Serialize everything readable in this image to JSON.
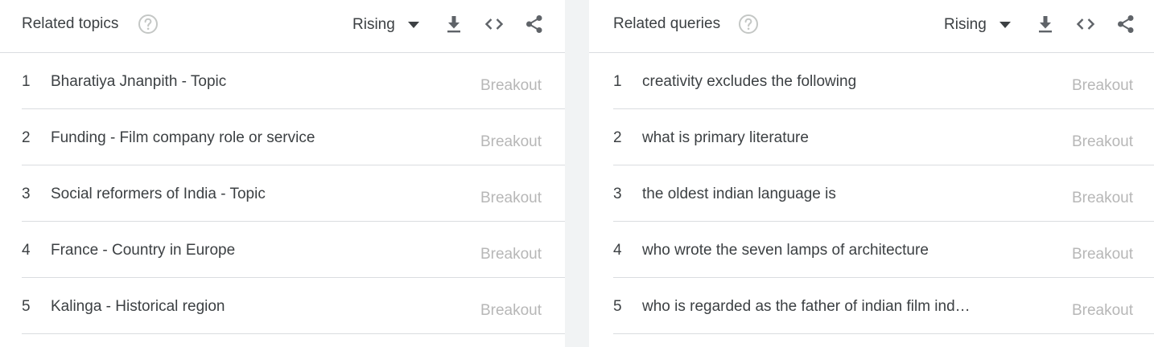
{
  "colors": {
    "background": "#f1f3f4",
    "panel": "#ffffff",
    "text": "#3c4043",
    "muted": "#b7b7b7",
    "icon": "#5f6368",
    "divider": "#dadce0"
  },
  "topics": {
    "title": "Related topics",
    "help_icon": "help-circle-icon",
    "sort": "Rising",
    "icons": [
      "download-icon",
      "embed-code-icon",
      "share-icon"
    ],
    "rows": [
      {
        "rank": "1",
        "label": "Bharatiya Jnanpith - Topic",
        "value": "Breakout"
      },
      {
        "rank": "2",
        "label": "Funding - Film company role or service",
        "value": "Breakout"
      },
      {
        "rank": "3",
        "label": "Social reformers of India - Topic",
        "value": "Breakout"
      },
      {
        "rank": "4",
        "label": "France - Country in Europe",
        "value": "Breakout"
      },
      {
        "rank": "5",
        "label": "Kalinga - Historical region",
        "value": "Breakout"
      }
    ]
  },
  "queries": {
    "title": "Related queries",
    "help_icon": "help-circle-icon",
    "sort": "Rising",
    "icons": [
      "download-icon",
      "embed-code-icon",
      "share-icon"
    ],
    "rows": [
      {
        "rank": "1",
        "label": "creativity excludes the following",
        "value": "Breakout"
      },
      {
        "rank": "2",
        "label": "what is primary literature",
        "value": "Breakout"
      },
      {
        "rank": "3",
        "label": "the oldest indian language is",
        "value": "Breakout"
      },
      {
        "rank": "4",
        "label": "who wrote the seven lamps of architecture",
        "value": "Breakout"
      },
      {
        "rank": "5",
        "label": "who is regarded as the father of indian film ind…",
        "value": "Breakout"
      }
    ]
  }
}
